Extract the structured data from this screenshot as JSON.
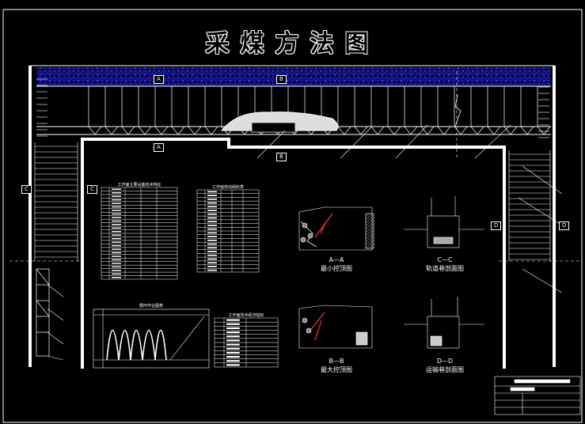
{
  "title": "采煤方法图",
  "section_marks": {
    "a_top": "A",
    "a_bottom": "A",
    "b_top": "B",
    "b_bottom": "B",
    "c_left": "C",
    "c_right": "C",
    "d_left": "D",
    "d_right": "D"
  },
  "tables": {
    "t1_title": "工作面主要设备技术特征",
    "t2_title": "工作面劳动组织表",
    "t3_title": "循环作业图表",
    "t4_title": "工作面技术经济指标"
  },
  "views": {
    "aa_code": "A—A",
    "aa_name": "最小控顶图",
    "bb_code": "B—B",
    "bb_name": "最大控顶图",
    "cc_code": "C—C",
    "cc_name": "轨道巷剖面图",
    "dd_code": "D—D",
    "dd_name": "运输巷剖面图"
  }
}
